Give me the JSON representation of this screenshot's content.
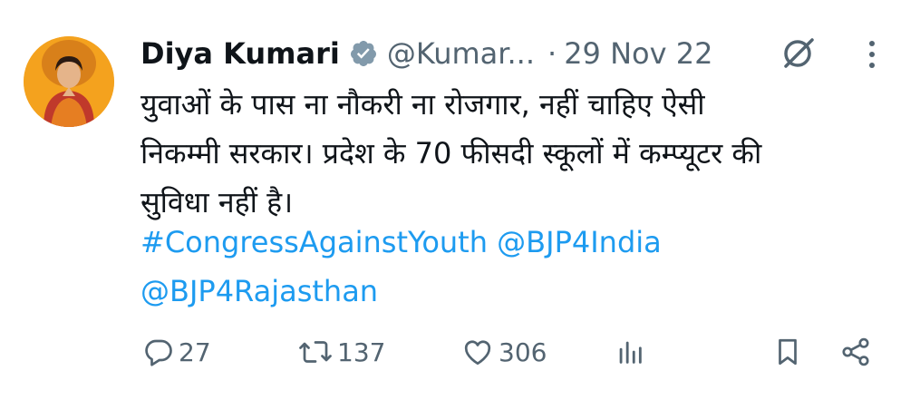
{
  "author": {
    "name": "Diya Kumari",
    "handle": "@Kumar...",
    "separator": "·",
    "date": "29 Nov 22"
  },
  "tweet": {
    "lines": [
      "युवाओं के पास ना नौकरी ना रोजगार, नहीं चाहिए ऐसी",
      "निकम्मी सरकार। प्रदेश के 70 फीसदी स्कूलों में कम्प्यूटर की",
      "सुविधा नहीं है।"
    ],
    "hashtag": "#CongressAgainstYouth",
    "mention_1": "@BJP4India",
    "mention_2": "@BJP4Rajasthan"
  },
  "actions": {
    "replies": "27",
    "retweets": "137",
    "likes": "306"
  },
  "colors": {
    "link": "#1d9bf0",
    "secondary_text": "#536471",
    "verified_badge": "#829aab",
    "avatar_background": "#f4a21e"
  },
  "icons": [
    "verified-badge-icon",
    "grok-icon",
    "more-icon",
    "reply-icon",
    "retweet-icon",
    "like-icon",
    "views-icon",
    "bookmark-icon",
    "share-icon"
  ]
}
